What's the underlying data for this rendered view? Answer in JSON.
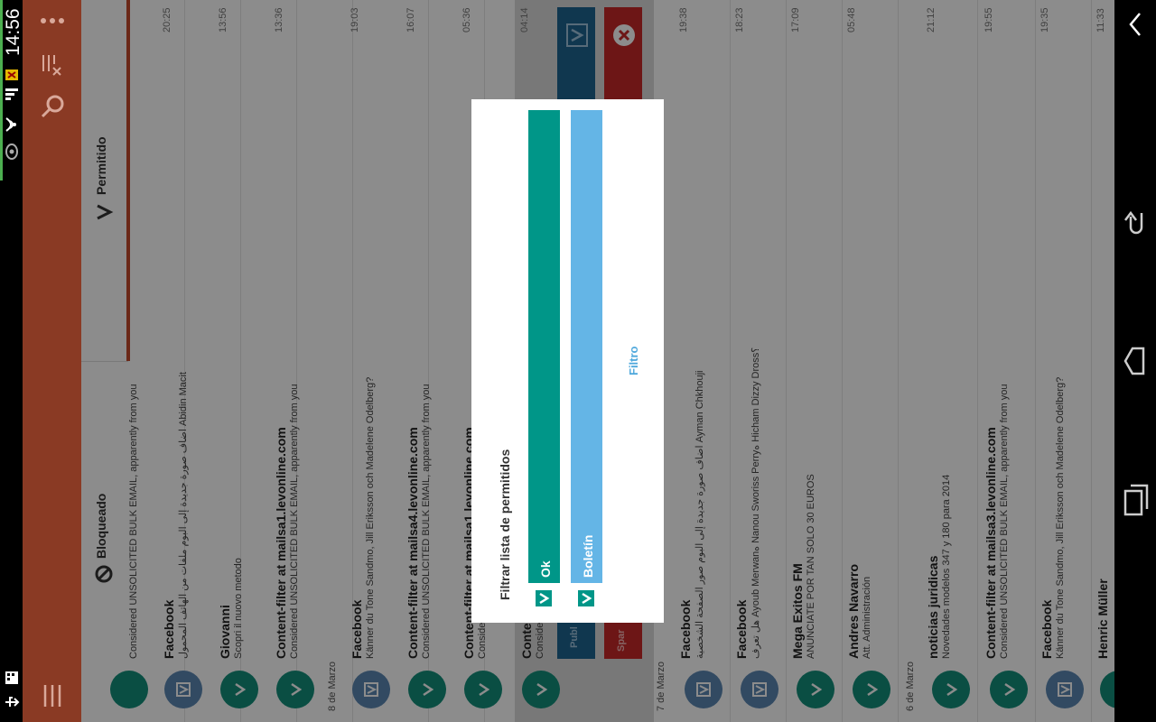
{
  "status": {
    "time": "14:56"
  },
  "tabs": {
    "blocked": "Bloqueado",
    "allowed": "Permitido"
  },
  "dates": {
    "d8": "8 de Marzo",
    "d7": "7 de Marzo",
    "d6": "6 de Marzo"
  },
  "messages": [
    {
      "sender": "",
      "snippet": "Considered UNSOLICITED BULK EMAIL, apparently from you",
      "time": ""
    },
    {
      "sender": "Facebook",
      "snippet": "اضاف صورة جديدة إلى البوم ملفات من الهاتف المحمول Abidin Macit",
      "time": "20:25"
    },
    {
      "sender": "Giovanni",
      "snippet": "Scopri il nuovo metodo",
      "time": "13:56"
    },
    {
      "sender": "Content-filter at mailsa1.levonline.com",
      "snippet": "Considered UNSOLICITED BULK EMAIL, apparently from you",
      "time": "13:36"
    },
    {
      "sender": "Facebook",
      "snippet": "Känner du Tone Sandmo, Jill Eriksson och Madelene Odelberg?",
      "time": "19:03"
    },
    {
      "sender": "Content-filter at mailsa4.levonline.com",
      "snippet": "Considered UNSOLICITED BULK EMAIL, apparently from you",
      "time": "16:07"
    },
    {
      "sender": "Content-filter at mailsa1.levonline.com",
      "snippet": "Conside",
      "time": "05:36"
    },
    {
      "sender": "Conte",
      "snippet": "Conside",
      "time": "04:14"
    },
    {
      "sender": "Facebook",
      "snippet": "اضاف صورة جديدة إلى البوم صور الصفحة الشخصية Ayman Chkhouji",
      "time": "19:38"
    },
    {
      "sender": "Facebook",
      "snippet": "هل تعرف Ayoub Merwanه Nanou Sworiss Perryه Hicham Dizzy Dross؟",
      "time": "18:23"
    },
    {
      "sender": "Mega Exitos FM",
      "snippet": "ANUNCIATE POR TAN SOLO 30 EUROS",
      "time": "17:09"
    },
    {
      "sender": "Andres Navarro",
      "snippet": "Att. Administración",
      "time": "05:48"
    },
    {
      "sender": "noticias juridicas",
      "snippet": "Novedades modelos 347 y 180 para 2014",
      "time": "21:12"
    },
    {
      "sender": "Content-filter at mailsa3.levonline.com",
      "snippet": "Considered UNSOLICITED BULK EMAIL, apparently from you",
      "time": "19:55"
    },
    {
      "sender": "Facebook",
      "snippet": "Känner du Tone Sandmo, Jill Eriksson och Madelene Odelberg?",
      "time": "19:35"
    },
    {
      "sender": "Henric Müller",
      "snippet": "",
      "time": "11:33"
    }
  ],
  "swipe": {
    "publish": "Publ",
    "spam": "Spar"
  },
  "dialog": {
    "title": "Filtrar lista de permitidos",
    "options": [
      {
        "label": "Ok",
        "color": "#009688"
      },
      {
        "label": "Boletín",
        "color": "#64B5E6"
      }
    ],
    "action": "Filtro"
  },
  "colors": {
    "actionbar": "#8A3A24",
    "accent_red": "#C62828",
    "accent_blue": "#1E6591"
  }
}
